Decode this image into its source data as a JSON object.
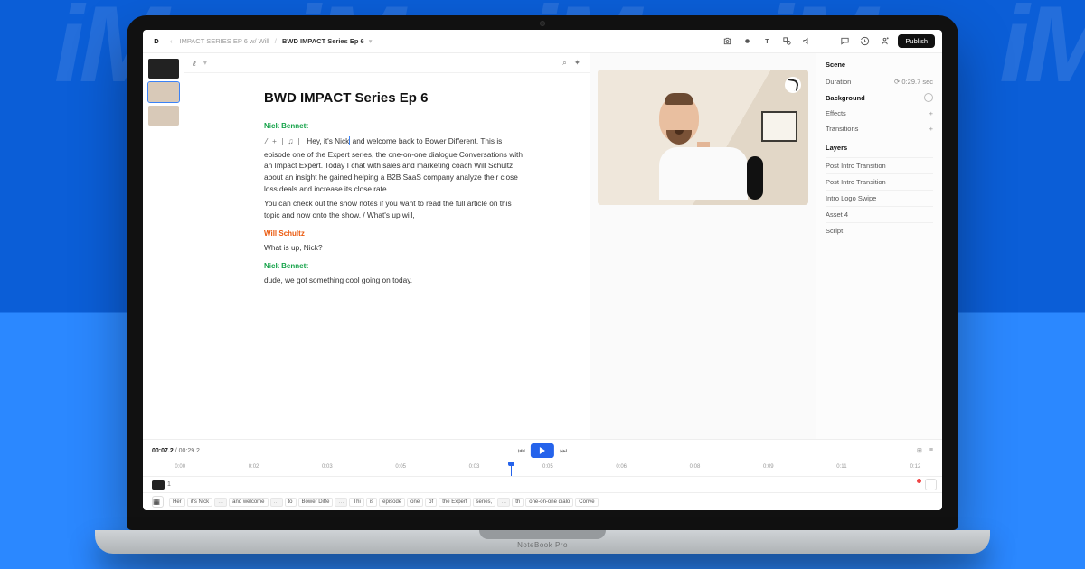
{
  "breadcrumb": {
    "home_icon": "D",
    "proj": "IMPACT SERIES EP 6 w/ Will",
    "doc": "BWD IMPACT Series Ep 6"
  },
  "toolbar": {
    "publish": "Publish"
  },
  "doc": {
    "title": "BWD IMPACT Series Ep 6",
    "sp1": "Nick Bennett",
    "p1a": "Hey, it's Nick",
    "p1b": "and welcome back to Bower Different. This is episode one of the Expert series, the one-on-one dialogue Conversations with an Impact Expert. Today I chat with sales and marketing coach Will Schultz about an insight he gained helping a B2B SaaS company analyze their close loss deals and increase its close rate.",
    "p2": "You can check out the show notes if you want to read the full article on this topic and now onto the show.  / What's up will,",
    "sp2": "Will Schultz",
    "p3": "What is up, Nick?",
    "sp3": "Nick Bennett",
    "p4": "dude, we got something cool going on today."
  },
  "right": {
    "scene": "Scene",
    "duration_label": "Duration",
    "duration_value": "0:29.7 sec",
    "background": "Background",
    "effects": "Effects",
    "transitions": "Transitions",
    "layers_label": "Layers",
    "layers": [
      "Post Intro Transition",
      "Post Intro Transition",
      "Intro Logo Swipe",
      "Asset 4",
      "Script"
    ]
  },
  "timeline": {
    "cur": "00:07.2",
    "total": "00:29.2",
    "ticks": [
      "0:00",
      "0:02",
      "0:03",
      "0:05",
      "0:03",
      "0:05",
      "0:06",
      "0:08",
      "0:09",
      "0:11",
      "0:12"
    ],
    "playhead_pct": 46,
    "tracknum": "1",
    "words": [
      "Her",
      "it's Nick",
      "…",
      "and welcome",
      "…",
      "to",
      "Bower Diffe",
      "…",
      "Thi",
      "is",
      "episode",
      "one",
      "of",
      "the Expert",
      "series,",
      "…",
      "th",
      "one-on-one dialo",
      "Conve"
    ]
  },
  "laptop_brand": "NoteBook Pro",
  "wm": "iM"
}
